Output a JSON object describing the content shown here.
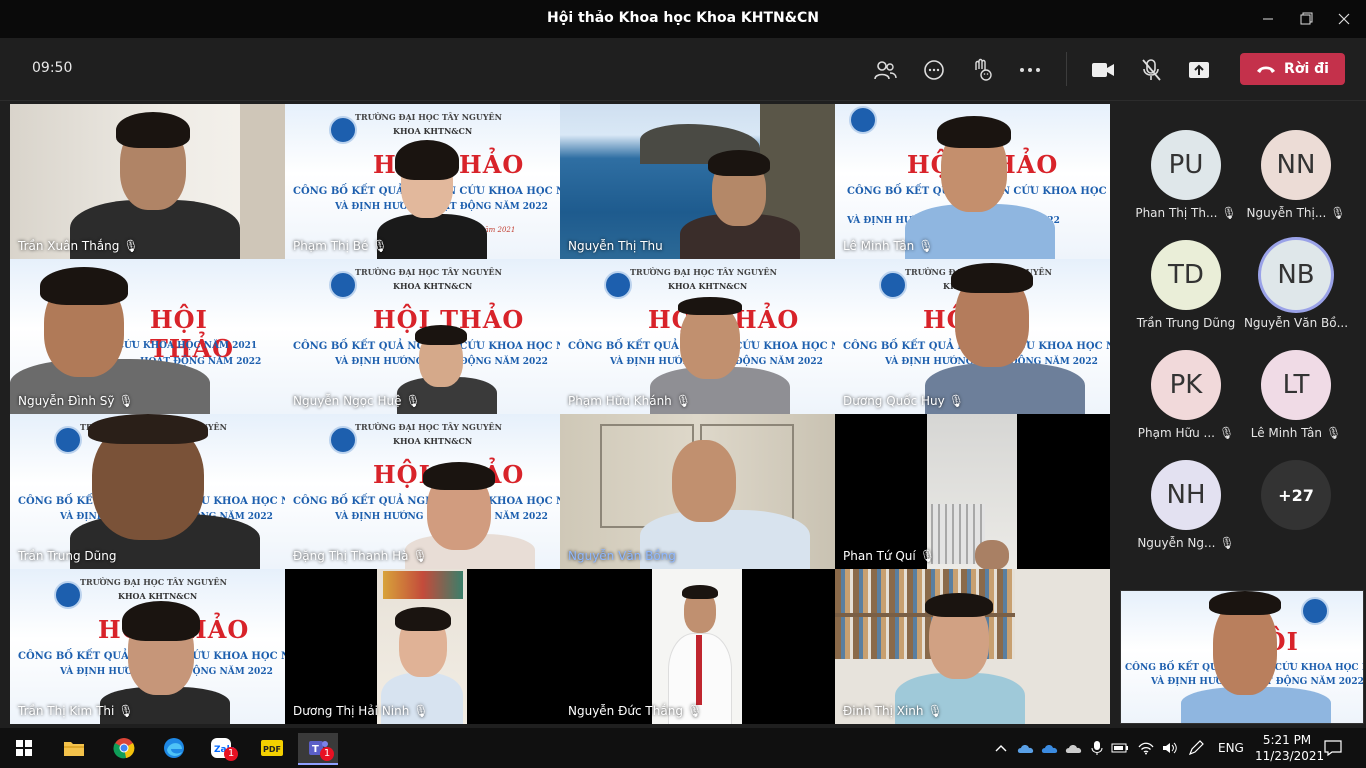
{
  "window": {
    "title": "Hội thảo Khoa học Khoa KHTN&CN",
    "minimize_icon": "minimize-icon",
    "maximize_icon": "maximize-icon",
    "close_icon": "close-icon"
  },
  "toolbar": {
    "time": "09:50",
    "leave_label": "Rời đi",
    "colors": {
      "leave": "#c4314b",
      "background": "#1f1f1f"
    }
  },
  "slide": {
    "school": "TRƯỜNG ĐẠI HỌC TÂY NGUYÊN",
    "faculty": "KHOA KHTN&CN",
    "title": "HỘI THẢO",
    "line1": "CÔNG BỐ KẾT QUẢ NGHIÊN CỨU KHOA HỌC NĂM 2021",
    "line2": "VÀ ĐỊNH HƯỚNG HOẠT ĐỘNG NĂM 2022",
    "date": "23 tháng 11 năm 2021"
  },
  "participants": [
    {
      "name": "Trần Xuân Thắng",
      "muted": true
    },
    {
      "name": "Phạm Thị Bé",
      "muted": true
    },
    {
      "name": "Nguyễn Thị Thu",
      "muted": false
    },
    {
      "name": "Lê Minh Tân",
      "muted": true
    },
    {
      "name": "Nguyễn Đình Sỹ",
      "muted": true
    },
    {
      "name": "Nguyễn Ngọc Huệ",
      "muted": true
    },
    {
      "name": "Phạm Hữu Khánh",
      "muted": true
    },
    {
      "name": "Dương Quốc Huy",
      "muted": true
    },
    {
      "name": "Trần Trung Dũng",
      "muted": false
    },
    {
      "name": "Đặng Thị Thanh Hà",
      "muted": true
    },
    {
      "name": "Nguyễn Văn Bồng",
      "muted": false
    },
    {
      "name": "Phan Tứ Quí",
      "muted": true
    },
    {
      "name": "Trần Thị Kim Thi",
      "muted": true
    },
    {
      "name": "Dương Thị Hải Ninh",
      "muted": true
    },
    {
      "name": "Nguyễn Đức Thắng",
      "muted": true
    },
    {
      "name": "Đinh Thị Xinh",
      "muted": true
    }
  ],
  "roster": [
    {
      "initials": "PU",
      "name": "Phan Thị Th...",
      "muted": true,
      "color": "#dfe7ea"
    },
    {
      "initials": "NN",
      "name": "Nguyễn Thị...",
      "muted": true,
      "color": "#ecdcd6"
    },
    {
      "initials": "TD",
      "name": "Trần Trung Dũng",
      "muted": false,
      "color": "#eaeed8"
    },
    {
      "initials": "NB",
      "name": "Nguyễn Văn Bồ...",
      "muted": false,
      "color": "#dfe7ea",
      "active": true
    },
    {
      "initials": "PK",
      "name": "Phạm Hữu ...",
      "muted": true,
      "color": "#f1d9da"
    },
    {
      "initials": "LT",
      "name": "Lê Minh Tân",
      "muted": true,
      "color": "#f0dbe6"
    },
    {
      "initials": "NH",
      "name": "Nguyễn Ng...",
      "muted": true,
      "color": "#e3e1f1"
    }
  ],
  "roster_more": "+27",
  "taskbar": {
    "language": "ENG",
    "time": "5:21 PM",
    "date": "11/23/2021",
    "badges": {
      "zalo": "1",
      "teams": "1"
    }
  }
}
